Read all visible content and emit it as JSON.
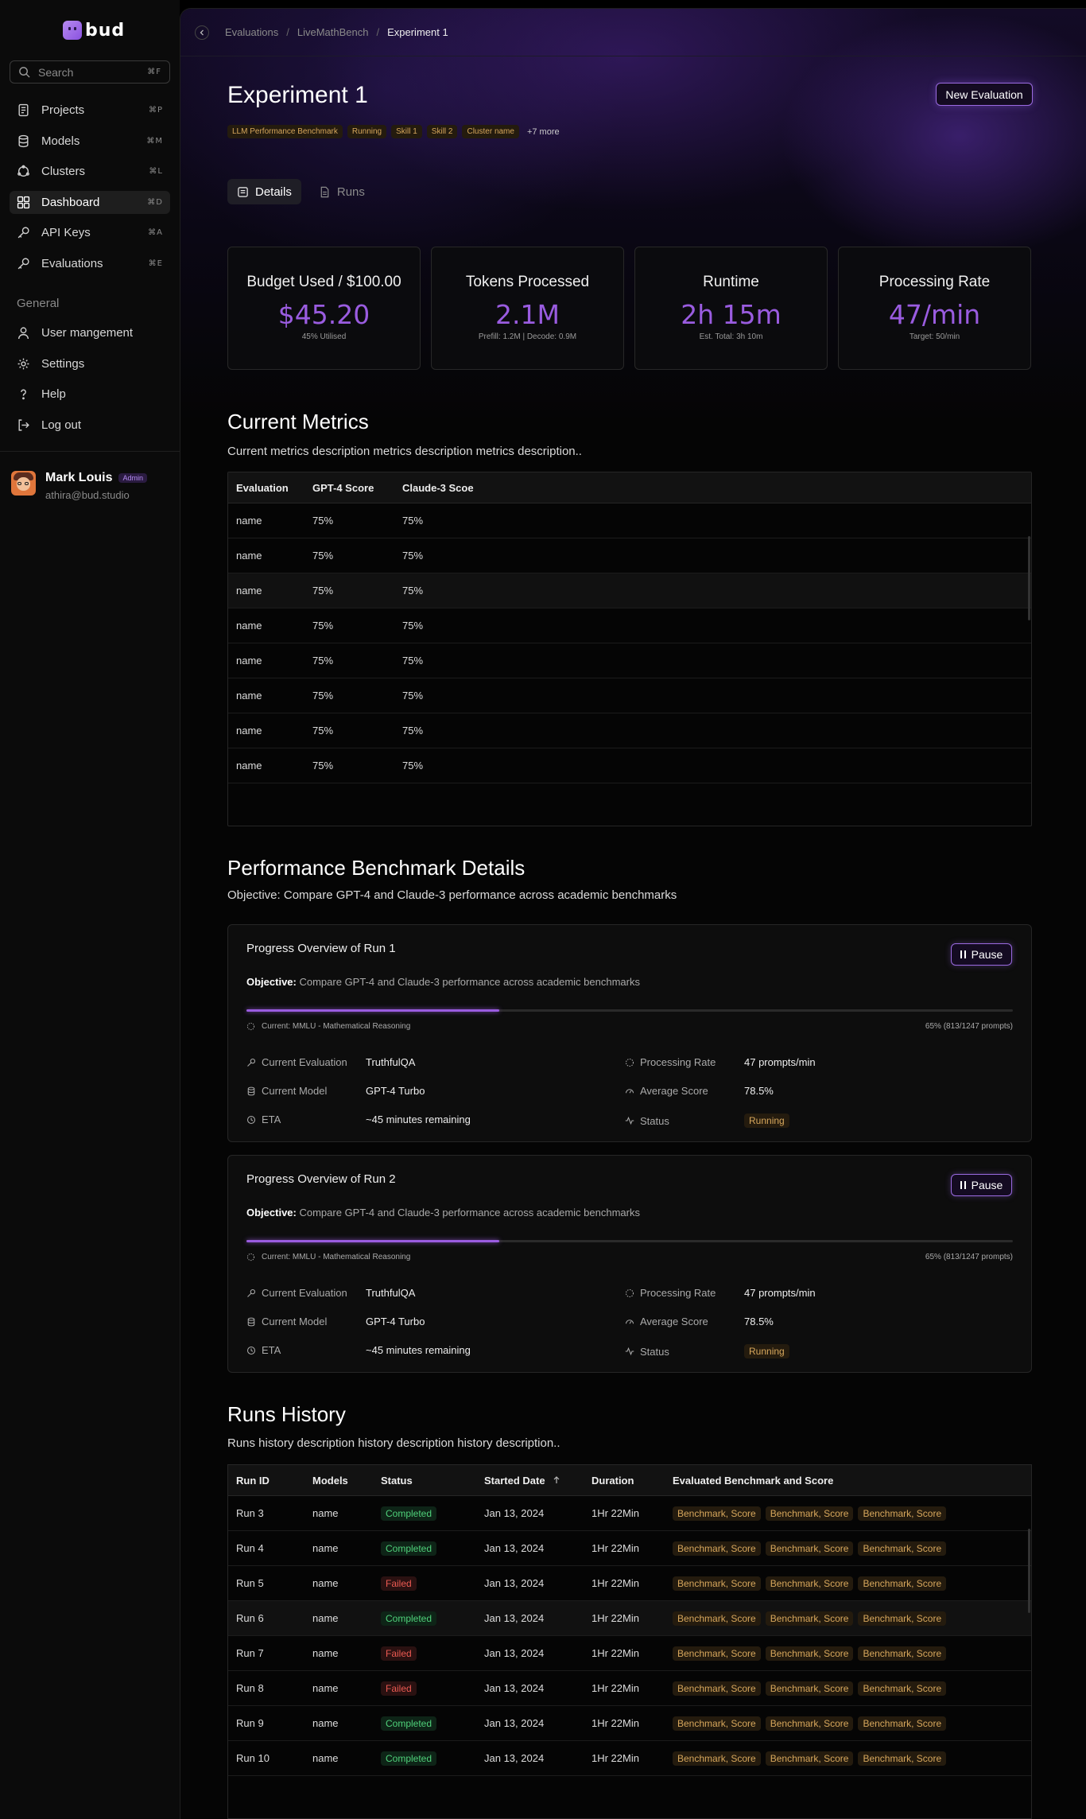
{
  "app": {
    "logo_text": "bud"
  },
  "search": {
    "placeholder": "Search",
    "shortcut": "⌘F"
  },
  "nav": [
    {
      "label": "Projects",
      "shortcut": "⌘P",
      "icon": "document-icon"
    },
    {
      "label": "Models",
      "shortcut": "⌘M",
      "icon": "database-icon"
    },
    {
      "label": "Clusters",
      "shortcut": "⌘L",
      "icon": "cluster-icon"
    },
    {
      "label": "Dashboard",
      "shortcut": "⌘D",
      "icon": "dashboard-icon",
      "active": true
    },
    {
      "label": "API Keys",
      "shortcut": "⌘A",
      "icon": "key-icon"
    },
    {
      "label": "Evaluations",
      "shortcut": "⌘E",
      "icon": "key-icon"
    }
  ],
  "general": {
    "label": "General",
    "items": [
      {
        "label": "User mangement",
        "icon": "user-icon"
      },
      {
        "label": "Settings",
        "icon": "gear-icon"
      },
      {
        "label": "Help",
        "icon": "help-icon"
      },
      {
        "label": "Log out",
        "icon": "logout-icon"
      }
    ]
  },
  "user": {
    "name": "Mark Louis",
    "role": "Admin",
    "email": "athira@bud.studio"
  },
  "breadcrumb": [
    "Evaluations",
    "LiveMathBench",
    "Experiment 1"
  ],
  "page": {
    "title": "Experiment 1",
    "new_eval_label": "New Evaluation",
    "tags": [
      "LLM Performance Benchmark",
      "Running",
      "Skill 1",
      "Skill 2",
      "Cluster name"
    ],
    "tags_more": "+7 more"
  },
  "tabs": [
    {
      "label": "Details",
      "active": true
    },
    {
      "label": "Runs",
      "active": false
    }
  ],
  "stats": [
    {
      "title": "Budget Used / $100.00",
      "value": "$45.20",
      "sub": "45% Utilised"
    },
    {
      "title": "Tokens Processed",
      "value": "2.1M",
      "sub": "Prefill: 1.2M | Decode: 0.9M"
    },
    {
      "title": "Runtime",
      "value": "2h 15m",
      "sub": "Est. Total: 3h 10m"
    },
    {
      "title": "Processing Rate",
      "value": "47/min",
      "sub": "Target: 50/min"
    }
  ],
  "metrics": {
    "title": "Current Metrics",
    "description": "Current metrics description metrics description metrics description..",
    "columns": [
      "Evaluation",
      "GPT-4 Score",
      "Claude-3 Scoe"
    ],
    "rows": [
      [
        "name",
        "75%",
        "75%"
      ],
      [
        "name",
        "75%",
        "75%"
      ],
      [
        "name",
        "75%",
        "75%"
      ],
      [
        "name",
        "75%",
        "75%"
      ],
      [
        "name",
        "75%",
        "75%"
      ],
      [
        "name",
        "75%",
        "75%"
      ],
      [
        "name",
        "75%",
        "75%"
      ],
      [
        "name",
        "75%",
        "75%"
      ]
    ]
  },
  "benchmark": {
    "title": "Performance Benchmark Details",
    "objective": "Objective: Compare GPT-4 and Claude-3 performance across academic benchmarks",
    "runs": [
      {
        "title": "Progress Overview of Run 1",
        "pause_label": "Pause",
        "objective_label": "Objective:",
        "objective": "Compare GPT-4 and Claude-3 performance across academic benchmarks",
        "progress": 0.33,
        "current": "Current: MMLU - Mathematical Reasoning",
        "percent_text": "65% (813/1247 prompts)",
        "current_evaluation_label": "Current Evaluation",
        "current_evaluation": "TruthfulQA",
        "current_model_label": "Current Model",
        "current_model": "GPT-4 Turbo",
        "eta_label": "ETA",
        "eta": "~45 minutes remaining",
        "processing_rate_label": "Processing Rate",
        "processing_rate": "47 prompts/min",
        "average_score_label": "Average Score",
        "average_score": "78.5%",
        "status_label": "Status",
        "status": "Running"
      },
      {
        "title": "Progress Overview of Run 2",
        "pause_label": "Pause",
        "objective_label": "Objective:",
        "objective": "Compare GPT-4 and Claude-3 performance across academic benchmarks",
        "progress": 0.33,
        "current": "Current: MMLU - Mathematical Reasoning",
        "percent_text": "65% (813/1247 prompts)",
        "current_evaluation_label": "Current Evaluation",
        "current_evaluation": "TruthfulQA",
        "current_model_label": "Current Model",
        "current_model": "GPT-4 Turbo",
        "eta_label": "ETA",
        "eta": "~45 minutes remaining",
        "processing_rate_label": "Processing Rate",
        "processing_rate": "47 prompts/min",
        "average_score_label": "Average Score",
        "average_score": "78.5%",
        "status_label": "Status",
        "status": "Running"
      }
    ]
  },
  "runs_history": {
    "title": "Runs History",
    "description": "Runs history description history description history description..",
    "columns": [
      "Run ID",
      "Models",
      "Status",
      "Started Date",
      "Duration",
      "Evaluated Benchmark and Score"
    ],
    "rows": [
      {
        "id": "Run 3",
        "model": "name",
        "status": "Completed",
        "date": "Jan 13, 2024",
        "duration": "1Hr 22Min",
        "benchmarks": [
          "Benchmark, Score",
          "Benchmark, Score",
          "Benchmark, Score"
        ]
      },
      {
        "id": "Run 4",
        "model": "name",
        "status": "Completed",
        "date": "Jan 13, 2024",
        "duration": "1Hr 22Min",
        "benchmarks": [
          "Benchmark, Score",
          "Benchmark, Score",
          "Benchmark, Score"
        ]
      },
      {
        "id": "Run 5",
        "model": "name",
        "status": "Failed",
        "date": "Jan 13, 2024",
        "duration": "1Hr 22Min",
        "benchmarks": [
          "Benchmark, Score",
          "Benchmark, Score",
          "Benchmark, Score"
        ]
      },
      {
        "id": "Run 6",
        "model": "name",
        "status": "Completed",
        "date": "Jan 13, 2024",
        "duration": "1Hr 22Min",
        "benchmarks": [
          "Benchmark, Score",
          "Benchmark, Score",
          "Benchmark, Score"
        ]
      },
      {
        "id": "Run 7",
        "model": "name",
        "status": "Failed",
        "date": "Jan 13, 2024",
        "duration": "1Hr 22Min",
        "benchmarks": [
          "Benchmark, Score",
          "Benchmark, Score",
          "Benchmark, Score"
        ]
      },
      {
        "id": "Run 8",
        "model": "name",
        "status": "Failed",
        "date": "Jan 13, 2024",
        "duration": "1Hr 22Min",
        "benchmarks": [
          "Benchmark, Score",
          "Benchmark, Score",
          "Benchmark, Score"
        ]
      },
      {
        "id": "Run 9",
        "model": "name",
        "status": "Completed",
        "date": "Jan 13, 2024",
        "duration": "1Hr 22Min",
        "benchmarks": [
          "Benchmark, Score",
          "Benchmark, Score",
          "Benchmark, Score"
        ]
      },
      {
        "id": "Run 10",
        "model": "name",
        "status": "Completed",
        "date": "Jan 13, 2024",
        "duration": "1Hr 22Min",
        "benchmarks": [
          "Benchmark, Score",
          "Benchmark, Score",
          "Benchmark, Score"
        ]
      }
    ]
  },
  "colors": {
    "accent": "#9A5CE0",
    "running": "#D7A75C",
    "completed": "#4FD17A",
    "failed": "#EC5A52"
  }
}
